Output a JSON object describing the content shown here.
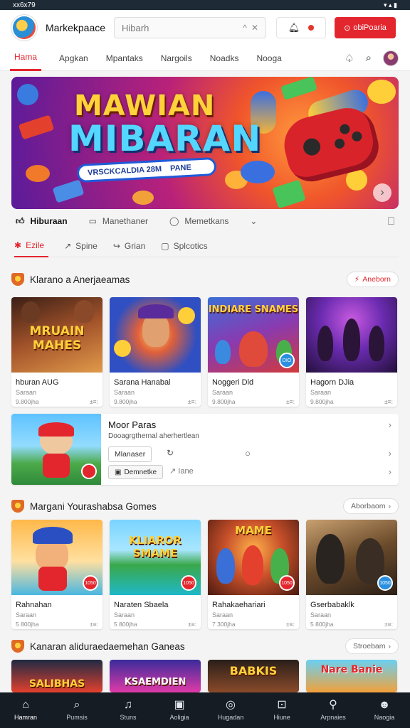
{
  "statusbar": {
    "time": "xx6x79",
    "icons": "▾ ▴ ▮"
  },
  "header": {
    "brand": "Markekpaace",
    "search_placeholder": "Hibarh",
    "search_up": "^",
    "search_clear": "✕",
    "cta_label": "obiPoaria"
  },
  "nav": {
    "tabs": [
      "Hama",
      "Apgkan",
      "Mpantaks",
      "Nargoils",
      "Noadks",
      "Nooga"
    ]
  },
  "banner": {
    "line1": "MAWIAN",
    "line2": "MIBARAN",
    "pill_a": "VRSCKCALDIA 28M",
    "pill_b": "PANE",
    "next_icon": "›"
  },
  "actions": [
    "Hiburaan",
    "Manethaner",
    "Memetkans"
  ],
  "subtabs": [
    "Ezile",
    "Spine",
    "Grian",
    "Splcotics"
  ],
  "section1": {
    "title": "Klarano a Anerjaeamas",
    "link": "Aneborn",
    "cards": [
      {
        "thumb_text": "MRUAIN MAHES",
        "name": "hburan AUG",
        "sub": "Saraan",
        "meta": "9.800jha",
        "meta2": "±≡:",
        "bg": "#7a3a1e"
      },
      {
        "thumb_text": "",
        "name": "Sarana Hanabal",
        "sub": "Saraan",
        "meta": "9.800jha",
        "meta2": "±≡:",
        "bg": "#2f69d2"
      },
      {
        "thumb_text": "INDIARE SNAMES",
        "name": "Noggeri Dld",
        "sub": "Saraan",
        "meta": "9.800jha",
        "meta2": "±≡:",
        "bg": "#d23a3a"
      },
      {
        "thumb_text": "",
        "name": "Hagorn DJia",
        "sub": "Saraan",
        "meta": "9.800jha",
        "meta2": "±≡:",
        "bg": "#5a2b8a"
      }
    ]
  },
  "feature": {
    "title": "Moor Paras",
    "desc": "Dooagrgthernal aherhertlean",
    "button1": "Mlanaser",
    "button2": "Demnetke",
    "share": "Iane"
  },
  "section2": {
    "title": "Margani Yourashabsa Gomes",
    "link": "Aborbaom",
    "cards": [
      {
        "thumb_text": "",
        "name": "Rahnahan",
        "sub": "Saraan",
        "meta": "5 800jha",
        "meta2": "±≡:",
        "bg": "#f2a13a",
        "badge": "1050"
      },
      {
        "thumb_text": "KLIAROR SMAME",
        "name": "Naraten Sbaela",
        "sub": "Saraan",
        "meta": "5 800jha",
        "meta2": "±≡:",
        "bg": "#2bb7d8",
        "badge": "1050"
      },
      {
        "thumb_text": "MAME",
        "name": "Rahakaehariari",
        "sub": "Saraan",
        "meta": "7 300jha",
        "meta2": "±≡:",
        "bg": "#b4502a",
        "badge": "1050"
      },
      {
        "thumb_text": "",
        "name": "Gserbabaklk",
        "sub": "Saraan",
        "meta": "5 800jha",
        "meta2": "±≡:",
        "bg": "#4a3a2a",
        "badge": "1050"
      }
    ]
  },
  "section3": {
    "title": "Kanaran aliduraedaemehan Ganeas",
    "link": "Stroebam",
    "cards": [
      {
        "thumb_text": "SALIBHAS",
        "bg": "#1f2a44"
      },
      {
        "thumb_text": "KSAEMDIEN",
        "bg": "#c02a8a"
      },
      {
        "thumb_text": "BABKIS",
        "bg": "#2a1f1a"
      },
      {
        "thumb_text": "Nare Banie",
        "bg": "#6ad0f2"
      }
    ]
  },
  "bottomnav": [
    {
      "label": "Hamran",
      "icon": "⌂"
    },
    {
      "label": "Pumsis",
      "icon": "⌕"
    },
    {
      "label": "Stuns",
      "icon": "♫"
    },
    {
      "label": "Aoligia",
      "icon": "▣"
    },
    {
      "label": "Hugadan",
      "icon": "◎"
    },
    {
      "label": "Hiune",
      "icon": "⊡"
    },
    {
      "label": "Arpnaies",
      "icon": "⚲"
    },
    {
      "label": "Naogia",
      "icon": "☻"
    }
  ],
  "colors": {
    "accent": "#e3262e",
    "bottomnav": "#161c24"
  }
}
